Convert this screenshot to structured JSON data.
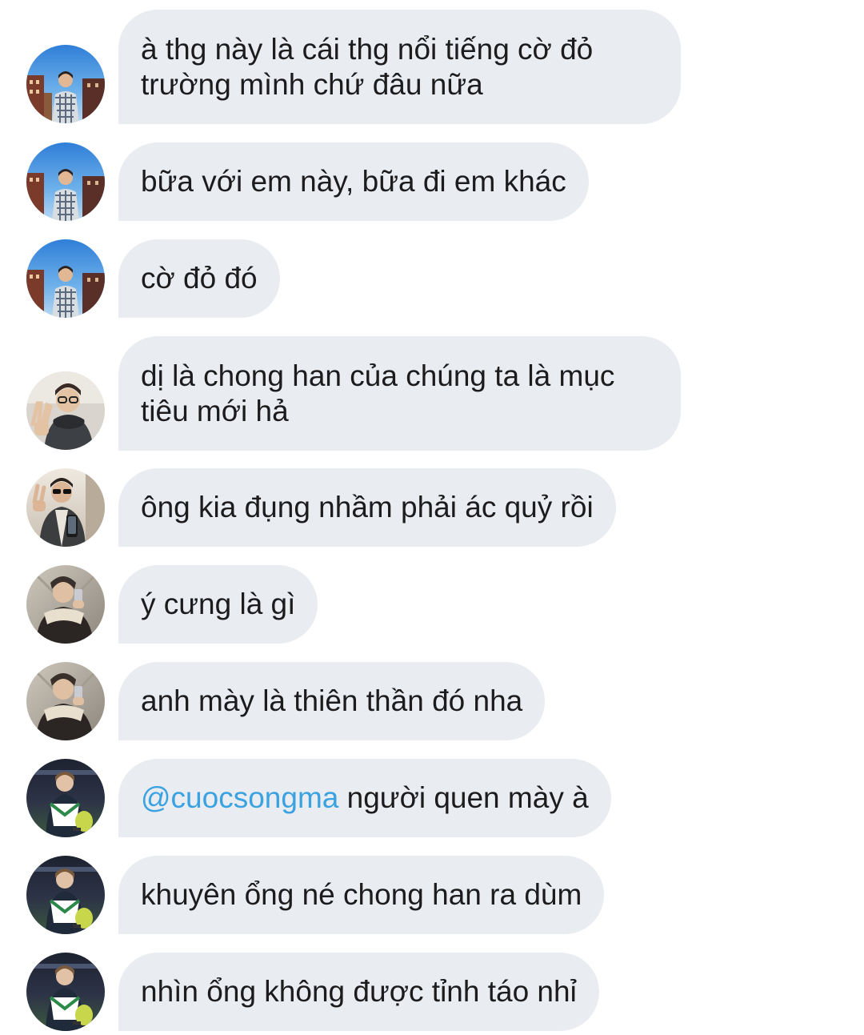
{
  "messages": [
    {
      "id": "m1",
      "avatar": "avatar-city-sunset",
      "text": "à thg này là cái thg nổi tiếng cờ đỏ trường mình chứ đâu nữa"
    },
    {
      "id": "m2",
      "avatar": "avatar-city-sunset",
      "text": "bữa với em này, bữa đi em khác"
    },
    {
      "id": "m3",
      "avatar": "avatar-city-sunset",
      "text": "cờ đỏ đó"
    },
    {
      "id": "m4",
      "avatar": "avatar-glasses-peace",
      "text": "dị là chong han của chúng ta là mục tiêu mới hả"
    },
    {
      "id": "m5",
      "avatar": "avatar-mirror-selfie",
      "text": "ông kia đụng nhầm phải ác quỷ rồi"
    },
    {
      "id": "m6",
      "avatar": "avatar-fur-jacket",
      "text": "ý cưng là gì"
    },
    {
      "id": "m7",
      "avatar": "avatar-fur-jacket",
      "text": "anh mày là thiên thần đó nha"
    },
    {
      "id": "m8",
      "avatar": "avatar-racket-sport",
      "mention": "@cuocsongma",
      "text": " người quen mày à"
    },
    {
      "id": "m9",
      "avatar": "avatar-racket-sport",
      "text": "khuyên ổng né chong han ra dùm"
    },
    {
      "id": "m10",
      "avatar": "avatar-racket-sport",
      "text": "nhìn ổng không được tỉnh táo nhỉ"
    }
  ],
  "colors": {
    "bubble_bg": "#e9ecf0",
    "text": "#1c1c1e",
    "mention": "#3aa2e0",
    "background": "#ffffff"
  }
}
